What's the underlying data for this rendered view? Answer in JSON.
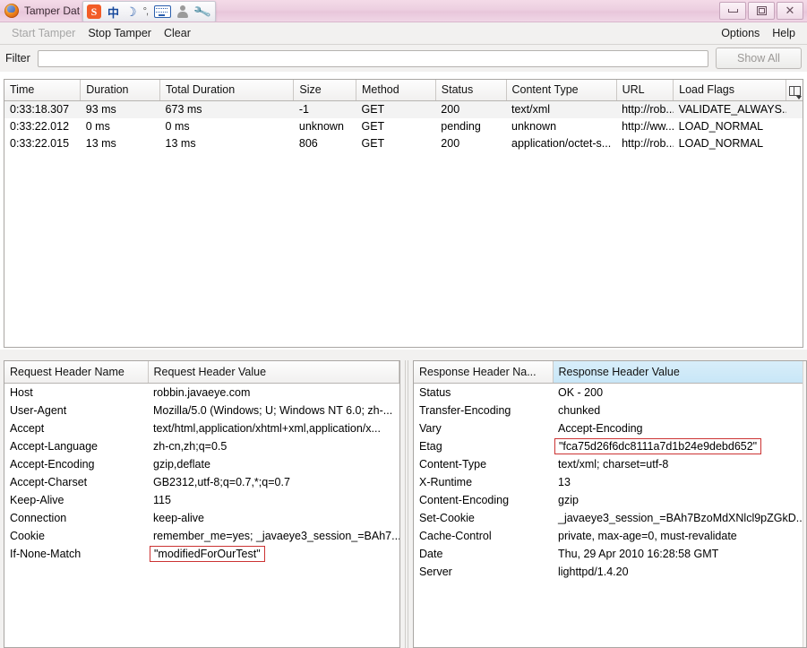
{
  "window": {
    "title": "Tamper Dat",
    "app_icon": "firefox-icon",
    "minimize_label": "Minimize",
    "maximize_label": "Maximize",
    "close_label": "✕"
  },
  "ime_toolbar": {
    "items": [
      {
        "name": "sogou-logo-icon",
        "label": "S"
      },
      {
        "name": "chinese-mode-icon",
        "label": "中"
      },
      {
        "name": "moon-icon",
        "label": "☽"
      },
      {
        "name": "punctuation-icon",
        "label": "°,"
      },
      {
        "name": "soft-keyboard-icon",
        "label": ""
      },
      {
        "name": "user-icon",
        "label": ""
      },
      {
        "name": "settings-wrench-icon",
        "label": "🔧"
      }
    ]
  },
  "menubar": {
    "start_tamper": "Start Tamper",
    "stop_tamper": "Stop Tamper",
    "clear": "Clear",
    "options": "Options",
    "help": "Help"
  },
  "filterbar": {
    "label": "Filter",
    "value": "",
    "placeholder": "",
    "show_all_label": "Show All"
  },
  "requests_table": {
    "columns": [
      "Time",
      "Duration",
      "Total Duration",
      "Size",
      "Method",
      "Status",
      "Content Type",
      "URL",
      "Load Flags"
    ],
    "column_selector_icon": "column-chooser-icon",
    "rows": [
      {
        "time": "0:33:18.307",
        "duration": "93 ms",
        "total_duration": "673 ms",
        "size": "-1",
        "method": "GET",
        "status": "200",
        "content_type": "text/xml",
        "url": "http://rob...",
        "load_flags": "VALIDATE_ALWAYS..."
      },
      {
        "time": "0:33:22.012",
        "duration": "0 ms",
        "total_duration": "0 ms",
        "size": "unknown",
        "method": "GET",
        "status": "pending",
        "content_type": "unknown",
        "url": "http://ww...",
        "load_flags": "LOAD_NORMAL"
      },
      {
        "time": "0:33:22.015",
        "duration": "13 ms",
        "total_duration": "13 ms",
        "size": "806",
        "method": "GET",
        "status": "200",
        "content_type": "application/octet-s...",
        "url": "http://rob...",
        "load_flags": "LOAD_NORMAL"
      }
    ]
  },
  "request_headers": {
    "col_name": "Request Header Name",
    "col_value": "Request Header Value",
    "rows": [
      {
        "name": "Host",
        "value": "robbin.javaeye.com",
        "highlight": false
      },
      {
        "name": "User-Agent",
        "value": "Mozilla/5.0 (Windows; U; Windows NT 6.0; zh-...",
        "highlight": false
      },
      {
        "name": "Accept",
        "value": "text/html,application/xhtml+xml,application/x...",
        "highlight": false
      },
      {
        "name": "Accept-Language",
        "value": "zh-cn,zh;q=0.5",
        "highlight": false
      },
      {
        "name": "Accept-Encoding",
        "value": "gzip,deflate",
        "highlight": false
      },
      {
        "name": "Accept-Charset",
        "value": "GB2312,utf-8;q=0.7,*;q=0.7",
        "highlight": false
      },
      {
        "name": "Keep-Alive",
        "value": "115",
        "highlight": false
      },
      {
        "name": "Connection",
        "value": "keep-alive",
        "highlight": false
      },
      {
        "name": "Cookie",
        "value": "remember_me=yes; _javaeye3_session_=BAh7...",
        "highlight": false
      },
      {
        "name": "If-None-Match",
        "value": "\"modifiedForOurTest\"",
        "highlight": true
      }
    ]
  },
  "response_headers": {
    "col_name": "Response Header Na...",
    "col_value": "Response Header Value",
    "rows": [
      {
        "name": "Status",
        "value": "OK - 200",
        "highlight": false
      },
      {
        "name": "Transfer-Encoding",
        "value": "chunked",
        "highlight": false
      },
      {
        "name": "Vary",
        "value": "Accept-Encoding",
        "highlight": false
      },
      {
        "name": "Etag",
        "value": "\"fca75d26f6dc8111a7d1b24e9debd652\"",
        "highlight": true
      },
      {
        "name": "Content-Type",
        "value": "text/xml; charset=utf-8",
        "highlight": false
      },
      {
        "name": "X-Runtime",
        "value": "13",
        "highlight": false
      },
      {
        "name": "Content-Encoding",
        "value": "gzip",
        "highlight": false
      },
      {
        "name": "Set-Cookie",
        "value": "_javaeye3_session_=BAh7BzoMdXNlcl9pZGkD...",
        "highlight": false
      },
      {
        "name": "Cache-Control",
        "value": "private, max-age=0, must-revalidate",
        "highlight": false
      },
      {
        "name": "Date",
        "value": "Thu, 29 Apr 2010 16:28:58 GMT",
        "highlight": false
      },
      {
        "name": "Server",
        "value": "lighttpd/1.4.20",
        "highlight": false
      }
    ]
  },
  "colors": {
    "titlebar_pink": "#eccfe0",
    "highlight_box": "#cc3333",
    "selected_column": "#c8e6f7",
    "chrome_gray": "#f2f1f0"
  }
}
